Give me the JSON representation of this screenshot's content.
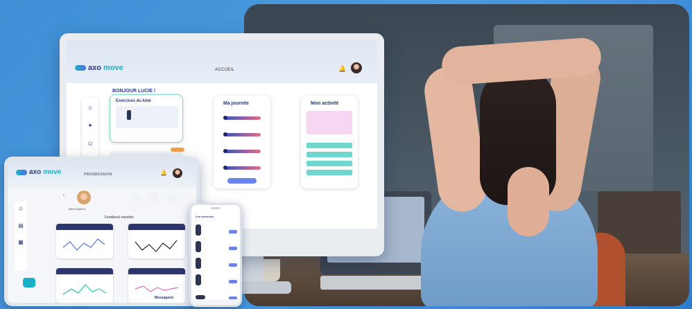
{
  "app": {
    "brand_a": "axo",
    "brand_b": "move"
  },
  "desktop": {
    "nav_title": "ACCUEIL",
    "greeting": "BONJOUR LUCIE !",
    "exercises_title": "Exercices du kiné",
    "journee_title": "Ma journée",
    "activite_title": "Mon activité"
  },
  "tablet": {
    "nav_title": "PROGRESSION",
    "patient_name": "Aline Equerre",
    "section_title": "Feedback reportés",
    "messages_label": "Messagerie"
  },
  "phone": {
    "title": "Les exercices"
  },
  "colors": {
    "background": "#3f8fd6",
    "brand_dark": "#2b3a7a",
    "brand_teal": "#1bb0c6",
    "accent_button": "#6c83e8",
    "chart_header": "#2e3470",
    "activity_pink": "#f7d6f2",
    "activity_teal": "#6fd6d0"
  }
}
